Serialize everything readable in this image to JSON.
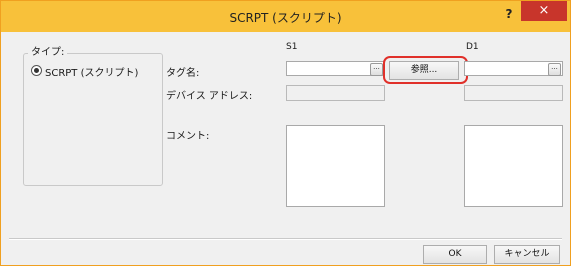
{
  "window": {
    "title": "SCRPT (スクリプト)",
    "help_label": "?",
    "close_label": "×"
  },
  "type_group": {
    "label": "タイプ:",
    "option_label": "SCRPT (スクリプト)"
  },
  "columns": {
    "s1": "S1",
    "d1": "D1"
  },
  "form": {
    "tag_name_label": "タグ名:",
    "device_address_label": "デバイス アドレス:",
    "comment_label": "コメント:",
    "s1_tag_value": "",
    "d1_tag_value": "",
    "browse_dots": "...",
    "browse_button_label": "参照..."
  },
  "footer": {
    "ok_label": "OK",
    "cancel_label": "キャンセル"
  }
}
